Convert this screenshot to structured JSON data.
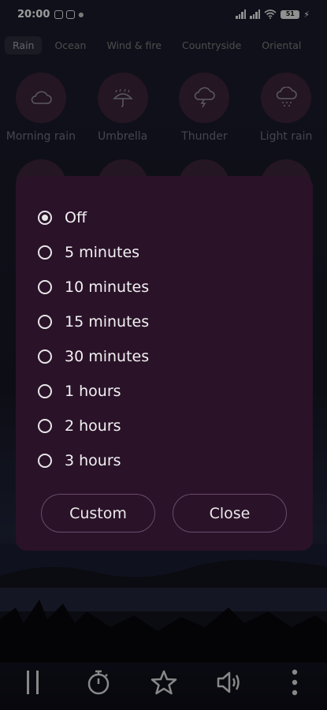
{
  "status_bar": {
    "time": "20:00",
    "battery": "51"
  },
  "tabs": [
    {
      "label": "Rain",
      "active": true
    },
    {
      "label": "Ocean"
    },
    {
      "label": "Wind & fire"
    },
    {
      "label": "Countryside"
    },
    {
      "label": "Oriental"
    }
  ],
  "sounds": [
    {
      "label": "Morning rain",
      "icon": "cloud-icon"
    },
    {
      "label": "Umbrella",
      "icon": "umbrella-icon"
    },
    {
      "label": "Thunder",
      "icon": "thunder-cloud-icon"
    },
    {
      "label": "Light rain",
      "icon": "light-rain-icon"
    }
  ],
  "timer_dialog": {
    "selected": "Off",
    "options": [
      "Off",
      "5 minutes",
      "10 minutes",
      "15 minutes",
      "30 minutes",
      "1 hours",
      "2 hours",
      "3 hours"
    ],
    "custom_label": "Custom",
    "close_label": "Close"
  },
  "bottom_bar": {
    "icons": [
      "pause-icon",
      "timer-icon",
      "star-icon",
      "volume-icon",
      "more-vert-icon"
    ]
  },
  "colors": {
    "dialog_bg": "#2a1229",
    "button_border": "#6a4c6a"
  }
}
